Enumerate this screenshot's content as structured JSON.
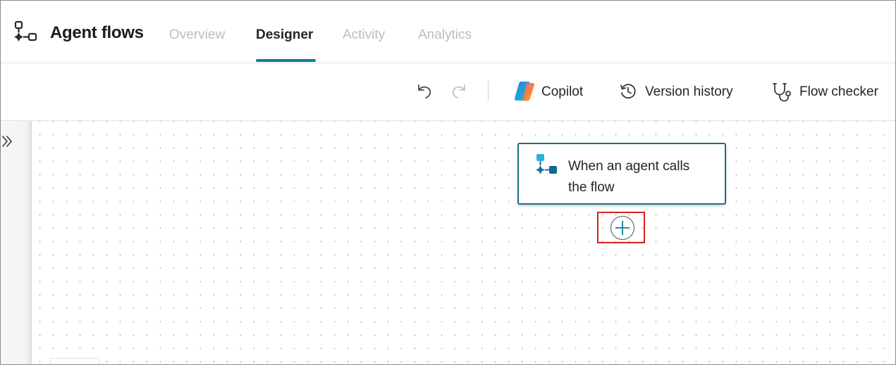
{
  "header": {
    "title": "Agent flows",
    "tabs": [
      {
        "label": "Overview",
        "active": false
      },
      {
        "label": "Designer",
        "active": true
      },
      {
        "label": "Activity",
        "active": false
      },
      {
        "label": "Analytics",
        "active": false
      }
    ]
  },
  "toolbar": {
    "undo_icon": "undo-icon",
    "redo_icon": "redo-icon",
    "copilot_label": "Copilot",
    "version_history_label": "Version history",
    "flow_checker_label": "Flow checker"
  },
  "canvas": {
    "trigger_card": {
      "line1": "When an agent calls",
      "line2": "the flow",
      "icon": "agent-flow-icon"
    },
    "add_step_icon": "plus-icon"
  },
  "colors": {
    "accent": "#117b9c",
    "card_border": "#1a6f8b",
    "highlight": "#d42323",
    "inactive_tab": "#bdbdbd"
  }
}
